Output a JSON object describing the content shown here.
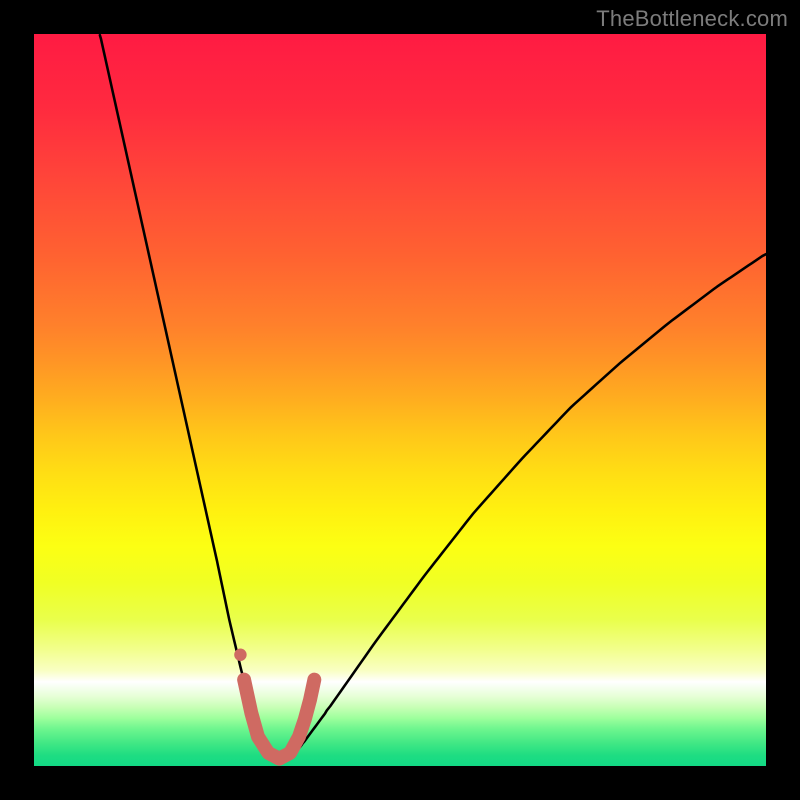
{
  "watermark": {
    "text": "TheBottleneck.com"
  },
  "colors": {
    "page_bg": "#000000",
    "watermark": "#7c7c7c",
    "curve": "#000000",
    "marker": "#cf6a62",
    "gradient_stops": [
      {
        "offset": 0.0,
        "color": "#ff1b43"
      },
      {
        "offset": 0.1,
        "color": "#ff2a3f"
      },
      {
        "offset": 0.2,
        "color": "#ff4639"
      },
      {
        "offset": 0.3,
        "color": "#ff6131"
      },
      {
        "offset": 0.4,
        "color": "#ff812b"
      },
      {
        "offset": 0.45,
        "color": "#ff9625"
      },
      {
        "offset": 0.5,
        "color": "#ffae1f"
      },
      {
        "offset": 0.55,
        "color": "#ffc819"
      },
      {
        "offset": 0.6,
        "color": "#ffde14"
      },
      {
        "offset": 0.65,
        "color": "#fff010"
      },
      {
        "offset": 0.7,
        "color": "#fcff13"
      },
      {
        "offset": 0.75,
        "color": "#f0ff24"
      },
      {
        "offset": 0.8,
        "color": "#e9ff4b"
      },
      {
        "offset": 0.84,
        "color": "#f2ff8b"
      },
      {
        "offset": 0.87,
        "color": "#f9ffc4"
      },
      {
        "offset": 0.885,
        "color": "#ffffff"
      },
      {
        "offset": 0.905,
        "color": "#e6ffd6"
      },
      {
        "offset": 0.92,
        "color": "#c7ffb5"
      },
      {
        "offset": 0.935,
        "color": "#9cff9c"
      },
      {
        "offset": 0.95,
        "color": "#6cf58e"
      },
      {
        "offset": 0.97,
        "color": "#3ee784"
      },
      {
        "offset": 0.985,
        "color": "#1fdd82"
      },
      {
        "offset": 1.0,
        "color": "#12d985"
      }
    ]
  },
  "chart_data": {
    "type": "line",
    "title": "",
    "xlabel": "",
    "ylabel": "",
    "xlim": [
      0,
      100
    ],
    "ylim": [
      0,
      100
    ],
    "series": [
      {
        "name": "bottleneck-curve",
        "x": [
          9,
          11,
          13,
          15,
          17,
          19,
          21,
          23,
          25,
          26.67,
          28.33,
          30,
          31.67,
          33.33,
          35,
          36.67,
          40,
          46.67,
          53.33,
          60,
          66.67,
          73.33,
          80,
          86.67,
          93.33,
          100
        ],
        "y": [
          100,
          91,
          82,
          73,
          64,
          55,
          46,
          37,
          28,
          20,
          13,
          7,
          3,
          1,
          1,
          3,
          7.5,
          17,
          26,
          34.5,
          42,
          49,
          55,
          60.5,
          65.5,
          70
        ],
        "note": "y is the visual height from bottom as a percentage; curve dips to ~1% around x≈34 then rises toward ~70% at x=100"
      }
    ],
    "markers": [
      {
        "name": "highlight-segment",
        "x": [
          28.7,
          29.7,
          30.6,
          32.0,
          33.5,
          35.0,
          36.2,
          37.0,
          37.7,
          38.3
        ],
        "y": [
          11.8,
          7.2,
          4.0,
          1.8,
          1.0,
          1.8,
          4.0,
          6.4,
          9.0,
          11.8
        ]
      },
      {
        "name": "highlight-dot",
        "x": 28.2,
        "y": 15.2
      }
    ]
  }
}
